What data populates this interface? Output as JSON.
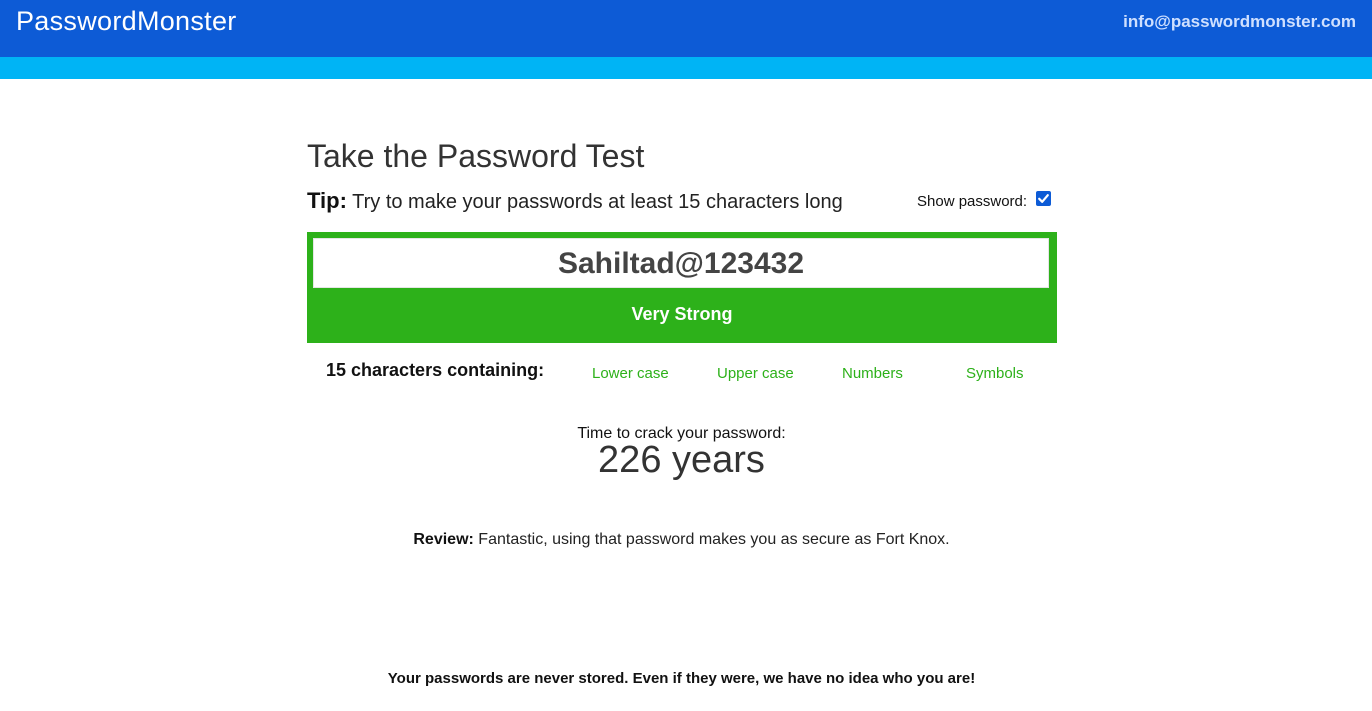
{
  "header": {
    "brand": "PasswordMonster",
    "email": "info@passwordmonster.com"
  },
  "main": {
    "title": "Take the Password Test",
    "tip_label": "Tip:",
    "tip_text": "Try to make your passwords at least 15 characters long",
    "show_password_label": "Show password:",
    "show_password_checked": true,
    "password_value": "Sahiltad@123432",
    "strength": "Very Strong",
    "characters_summary": "15 characters containing:",
    "character_types": [
      "Lower case",
      "Upper case",
      "Numbers",
      "Symbols"
    ],
    "crack_label": "Time to crack your password:",
    "crack_time": "226 years",
    "review_label": "Review:",
    "review_text": "Fantastic, using that password makes you as secure as Fort Knox."
  },
  "footer": {
    "note": "Your passwords are never stored. Even if they were, we have no idea who you are!"
  },
  "colors": {
    "header_bg": "#0d5bd6",
    "accent_bar": "#00b4f5",
    "strength_green": "#2db11a"
  }
}
